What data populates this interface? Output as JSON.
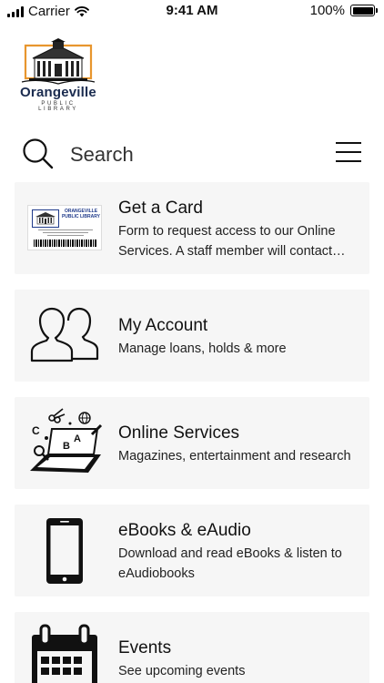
{
  "status_bar": {
    "carrier": "Carrier",
    "time": "9:41 AM",
    "battery": "100%",
    "battery_level": 1.0
  },
  "logo": {
    "name": "Orangeville",
    "subtitle": "PUBLIC LIBRARY",
    "accent_color": "#e8962e"
  },
  "search": {
    "placeholder": "Search",
    "icon": "search-icon",
    "menu_icon": "hamburger-menu-icon"
  },
  "items": [
    {
      "title": "Get a Card",
      "description": "Form to request access to our Online Services. A staff member will contact…",
      "icon": "library-card-image",
      "card_image_text": {
        "title": "ORANGEVILLE PUBLIC LIBRARY"
      }
    },
    {
      "title": "My Account",
      "description": "Manage loans, holds & more",
      "icon": "users-icon"
    },
    {
      "title": "Online Services",
      "description": "Magazines, entertainment and research",
      "icon": "laptop-online-services-icon"
    },
    {
      "title": "eBooks & eAudio",
      "description": "Download and read eBooks & listen to eAudiobooks",
      "icon": "smartphone-icon"
    },
    {
      "title": "Events",
      "description": "See upcoming events",
      "icon": "calendar-icon"
    }
  ]
}
